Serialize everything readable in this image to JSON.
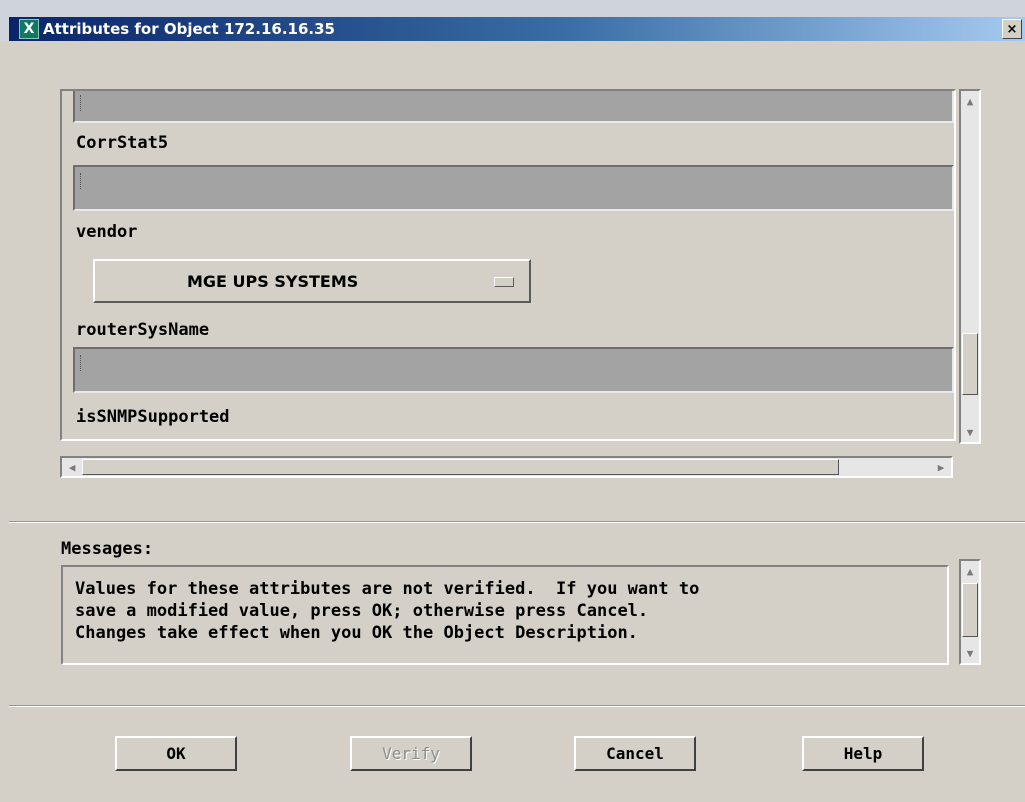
{
  "window": {
    "title": "Attributes for Object 172.16.16.35",
    "app_icon_glyph": "X",
    "close_glyph": "×"
  },
  "attributes": [
    {
      "label": "CorrStat5",
      "type": "text",
      "value": ""
    },
    {
      "label": "vendor",
      "type": "option",
      "value": "MGE UPS SYSTEMS"
    },
    {
      "label": "routerSysName",
      "type": "text",
      "value": ""
    },
    {
      "label": "isSNMPSupported",
      "type": "text",
      "value": ""
    }
  ],
  "scrollbars": {
    "up_arrow": "▲",
    "down_arrow": "▼",
    "left_arrow": "◀",
    "right_arrow": "▶"
  },
  "messages": {
    "label": "Messages:",
    "text": "Values for these attributes are not verified.  If you want to\nsave a modified value, press OK; otherwise press Cancel.\nChanges take effect when you OK the Object Description."
  },
  "buttons": {
    "ok": "OK",
    "verify": "Verify",
    "cancel": "Cancel",
    "help": "Help"
  },
  "colors": {
    "title_gradient_start": "#0a246a",
    "title_gradient_end": "#a6caf0",
    "dialog_bg": "#d4d0c8",
    "field_bg": "#a3a3a3",
    "disabled_text": "#8c8c8c"
  }
}
